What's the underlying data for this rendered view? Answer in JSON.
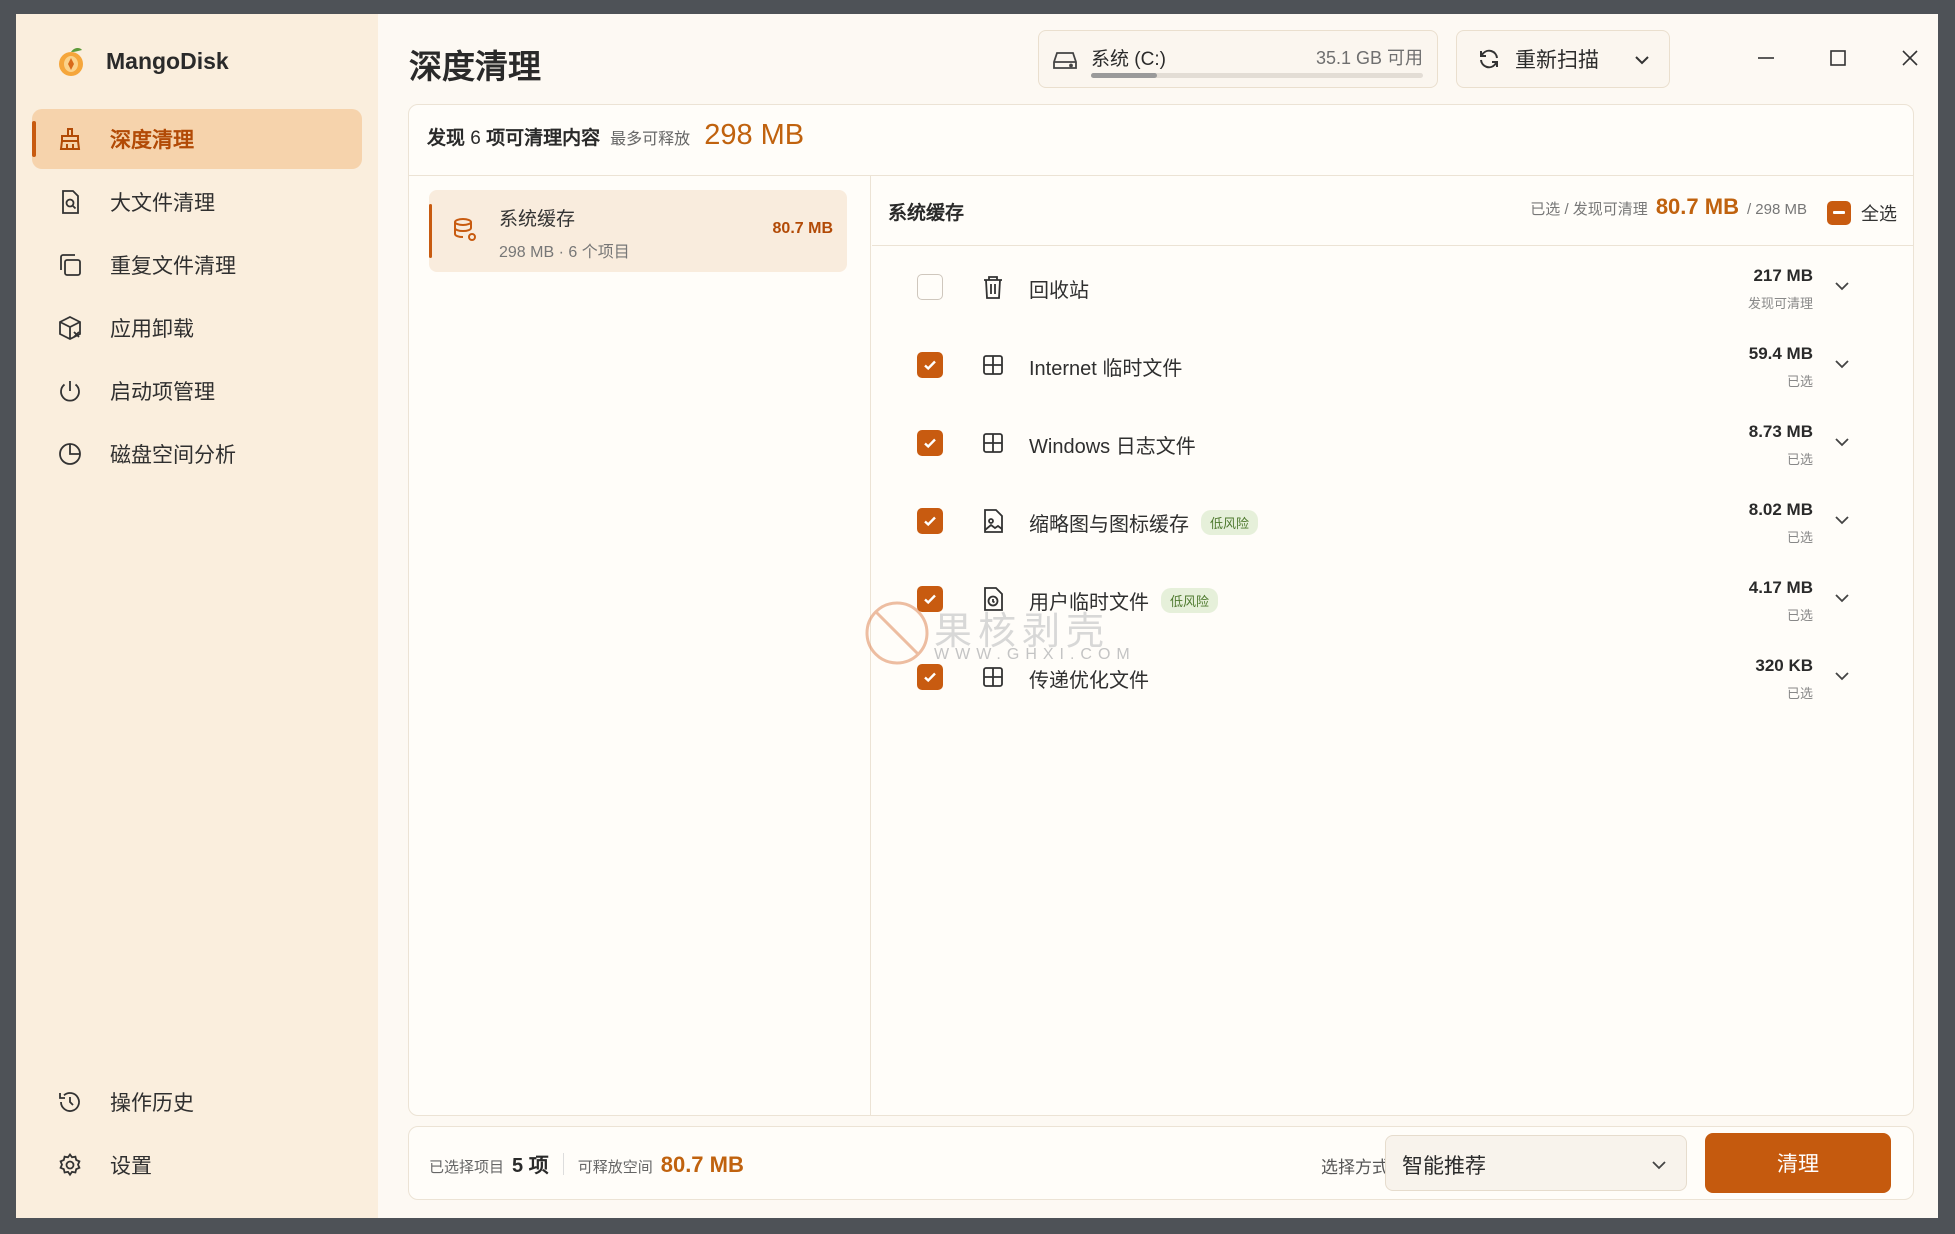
{
  "app": {
    "name": "MangoDisk"
  },
  "colors": {
    "accent": "#c85b10",
    "sidebar_bg": "#faeedd",
    "active_bg": "#f6d3ac",
    "badge_bg": "#e6f0da"
  },
  "sidebar": {
    "items": [
      {
        "label": "深度清理",
        "icon": "broom-icon",
        "active": true
      },
      {
        "label": "大文件清理",
        "icon": "file-search-icon"
      },
      {
        "label": "重复文件清理",
        "icon": "copy-icon"
      },
      {
        "label": "应用卸载",
        "icon": "package-remove-icon"
      },
      {
        "label": "启动项管理",
        "icon": "power-icon"
      },
      {
        "label": "磁盘空间分析",
        "icon": "pie-chart-icon"
      }
    ],
    "bottom": [
      {
        "label": "操作历史",
        "icon": "history-icon"
      },
      {
        "label": "设置",
        "icon": "gear-icon"
      }
    ]
  },
  "header": {
    "title": "深度清理",
    "drive": {
      "name": "系统 (C:)",
      "free": "35.1 GB 可用",
      "used_fraction": 0.2
    },
    "rescan_label": "重新扫描"
  },
  "summary": {
    "found_prefix": "发现",
    "found_count": "6",
    "found_suffix": "项可清理内容",
    "max_label": "最多可释放",
    "max_value": "298 MB"
  },
  "category": {
    "name": "系统缓存",
    "sub": "298 MB · 6 个项目",
    "size": "80.7 MB"
  },
  "detail": {
    "title": "系统缓存",
    "selected_label": "已选 / 发现可清理",
    "selected_value": "80.7 MB",
    "total": "/ 298 MB",
    "select_all_label": "全选",
    "items": [
      {
        "name": "回收站",
        "icon": "trash-icon",
        "checked": false,
        "size": "217 MB",
        "status": "发现可清理",
        "badge": ""
      },
      {
        "name": "Internet 临时文件",
        "icon": "windows-icon",
        "checked": true,
        "size": "59.4 MB",
        "status": "已选",
        "badge": ""
      },
      {
        "name": "Windows 日志文件",
        "icon": "windows-icon",
        "checked": true,
        "size": "8.73 MB",
        "status": "已选",
        "badge": ""
      },
      {
        "name": "缩略图与图标缓存",
        "icon": "image-file-icon",
        "checked": true,
        "size": "8.02 MB",
        "status": "已选",
        "badge": "低风险"
      },
      {
        "name": "用户临时文件",
        "icon": "clock-file-icon",
        "checked": true,
        "size": "4.17 MB",
        "status": "已选",
        "badge": "低风险"
      },
      {
        "name": "传递优化文件",
        "icon": "windows-icon",
        "checked": true,
        "size": "320 KB",
        "status": "已选",
        "badge": ""
      }
    ]
  },
  "bottom_bar": {
    "selected_label": "已选择项目",
    "selected_count": "5 项",
    "free_label": "可释放空间",
    "free_value": "80.7 MB",
    "mode_label": "选择方式",
    "mode_value": "智能推荐",
    "clean_label": "清理"
  },
  "watermark": {
    "text": "果核剥壳",
    "sub": "WWW.GHXI.COM"
  }
}
